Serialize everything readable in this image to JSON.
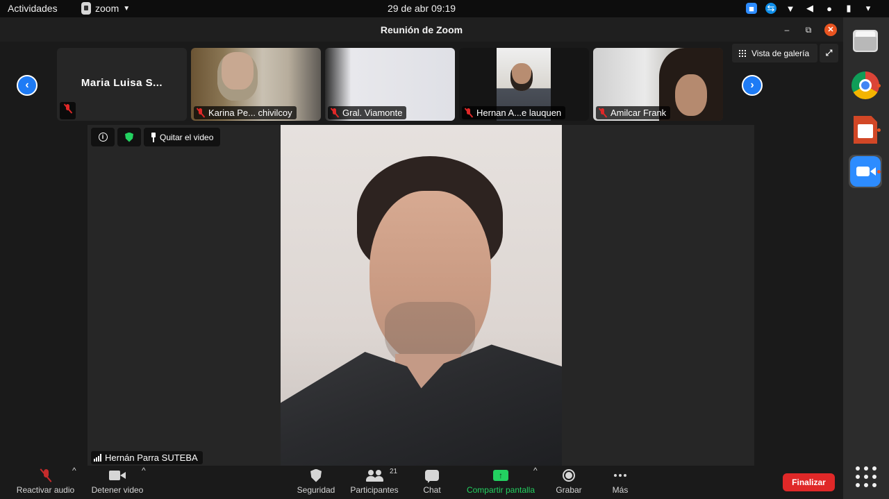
{
  "topbar": {
    "activities": "Actividades",
    "app_name": "zoom",
    "clock": "29 de abr  09:19"
  },
  "window": {
    "title": "Reunión de Zoom",
    "min": "–",
    "max": "⧉",
    "close": "✕"
  },
  "gallery": {
    "prev": "‹",
    "next": "›",
    "view_label": "Vista de galería",
    "fullscreen": "⤢",
    "participants": [
      {
        "name": "Maria Luisa S..."
      },
      {
        "name": "Karina Pe... chivilcoy"
      },
      {
        "name": "Gral. Viamonte"
      },
      {
        "name": "Hernan A...e lauquen"
      },
      {
        "name": "Amilcar Frank"
      }
    ]
  },
  "main_video": {
    "info": "i",
    "unpin_label": "Quitar el video",
    "speaker": "Hernán Parra SUTEBA"
  },
  "toolbar": {
    "audio_label": "Reactivar audio",
    "video_label": "Detener video",
    "security_label": "Seguridad",
    "participants_label": "Participantes",
    "participants_count": "21",
    "chat_label": "Chat",
    "share_label": "Compartir pantalla",
    "share_icon": "↑",
    "record_label": "Grabar",
    "more_label": "Más",
    "end_label": "Finalizar",
    "caret": "^"
  },
  "colors": {
    "accent_blue": "#1e7bf5",
    "end_red": "#e02828",
    "share_green": "#23d160",
    "ubuntu_orange": "#e95420"
  }
}
